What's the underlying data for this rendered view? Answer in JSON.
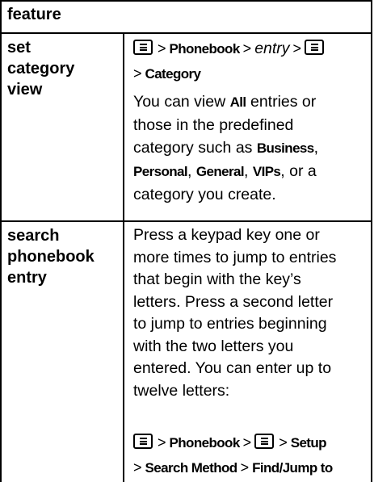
{
  "table": {
    "header": "feature",
    "rows": [
      {
        "feature": [
          "set",
          "category",
          "view"
        ],
        "path": {
          "sep": ">",
          "phonebook": "Phonebook",
          "entry": "entry",
          "category": "Category"
        },
        "description": {
          "p1": "You can view",
          "all": "All",
          "p2": "entries or those in the predefined category such as",
          "business": "Business",
          "personal": "Personal",
          "general": "General",
          "vips": "VIPs",
          "or": ", or a",
          "p3": "category you create."
        }
      },
      {
        "feature": [
          "search",
          "phonebook",
          "entry"
        ],
        "description_lines": [
          "Press a keypad key one or",
          "more times to jump to entries",
          "that begin with the key’s",
          "letters. Press a second letter",
          "to jump to entries beginning",
          "with the two letters you",
          "entered. You can enter up to",
          "twelve letters:"
        ],
        "path": {
          "sep": ">",
          "phonebook": "Phonebook",
          "setup": "Setup",
          "search_method": "Search Method",
          "find_jump": "Find/Jump to"
        }
      }
    ]
  },
  "icons": {
    "menu_key": "menu-key-icon"
  }
}
